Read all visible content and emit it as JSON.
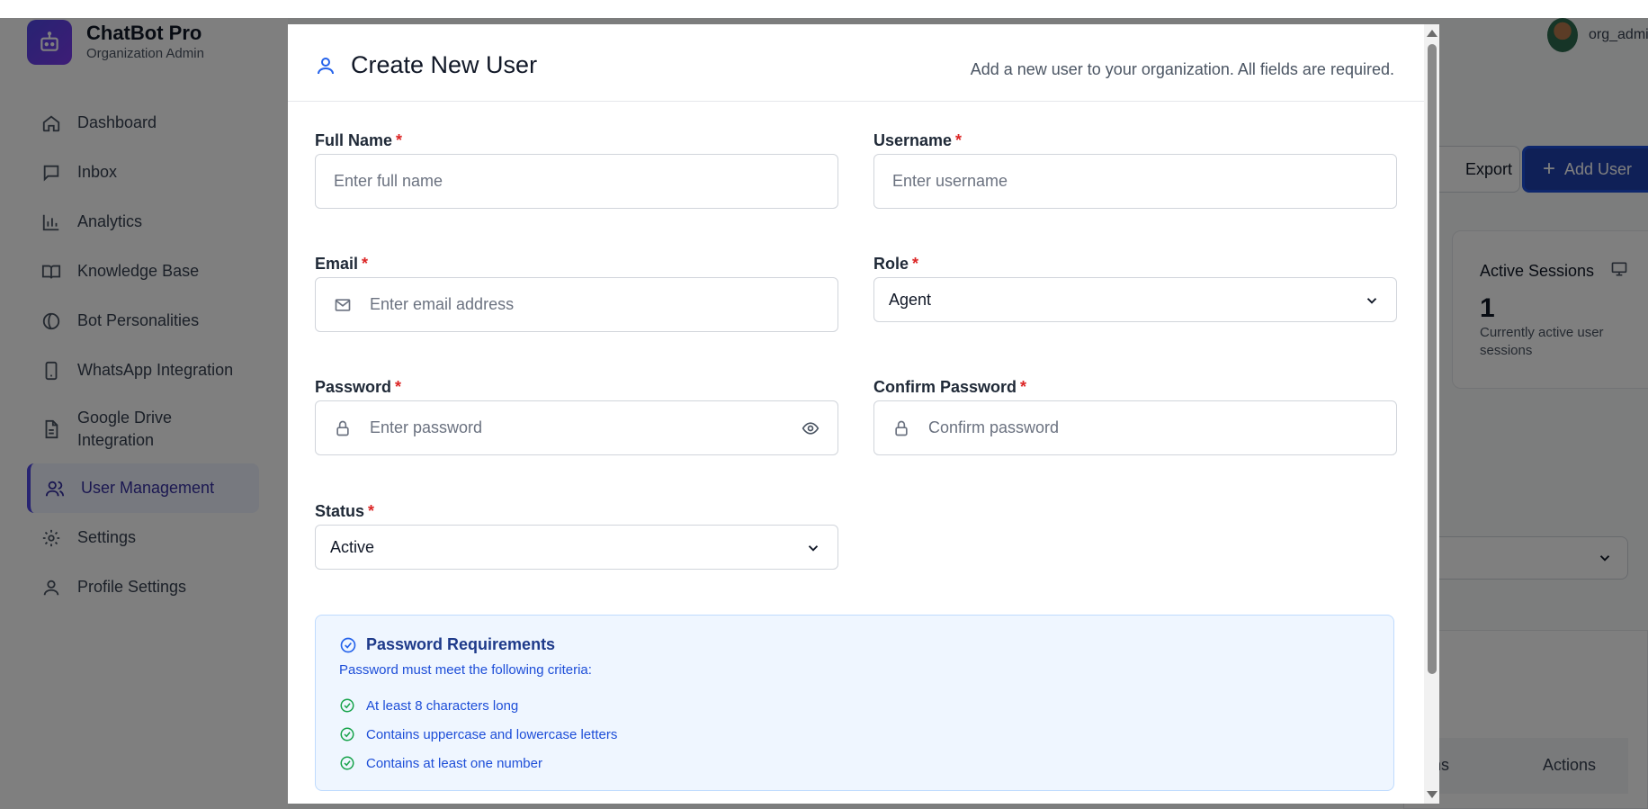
{
  "app": {
    "name": "ChatBot Pro",
    "subtitle": "Organization Admin",
    "user": "org_admi"
  },
  "sidebar": {
    "items": [
      {
        "label": "Dashboard",
        "icon": "home-icon"
      },
      {
        "label": "Inbox",
        "icon": "message-icon"
      },
      {
        "label": "Analytics",
        "icon": "bar-chart-icon"
      },
      {
        "label": "Knowledge Base",
        "icon": "book-icon"
      },
      {
        "label": "Bot Personalities",
        "icon": "personality-icon"
      },
      {
        "label": "WhatsApp Integration",
        "icon": "phone-icon"
      },
      {
        "label": "Google Drive Integration",
        "icon": "file-icon"
      },
      {
        "label": "User Management",
        "icon": "users-icon",
        "active": true
      },
      {
        "label": "Settings",
        "icon": "gear-icon"
      },
      {
        "label": "Profile Settings",
        "icon": "user-icon"
      }
    ]
  },
  "main": {
    "export_label": "Export",
    "add_user_label": "Add User",
    "sessions_card": {
      "title": "Active Sessions",
      "value": "1",
      "description": "Currently active user sessions"
    },
    "table_headers": [
      "ssions",
      "Actions"
    ]
  },
  "modal": {
    "title": "Create New User",
    "description": "Add a new user to your organization. All fields are required.",
    "required_mark": "*",
    "fields": {
      "full_name": {
        "label": "Full Name",
        "placeholder": "Enter full name"
      },
      "username": {
        "label": "Username",
        "placeholder": "Enter username"
      },
      "email": {
        "label": "Email",
        "placeholder": "Enter email address"
      },
      "role": {
        "label": "Role",
        "value": "Agent"
      },
      "password": {
        "label": "Password",
        "placeholder": "Enter password"
      },
      "confirm_password": {
        "label": "Confirm Password",
        "placeholder": "Confirm password"
      },
      "status": {
        "label": "Status",
        "value": "Active"
      }
    },
    "requirements": {
      "title": "Password Requirements",
      "subtitle": "Password must meet the following criteria:",
      "items": [
        "At least 8 characters long",
        "Contains uppercase and lowercase letters",
        "Contains at least one number"
      ]
    }
  },
  "colors": {
    "accent": "#1e40af",
    "required": "#dc2626",
    "check": "#16a34a"
  }
}
